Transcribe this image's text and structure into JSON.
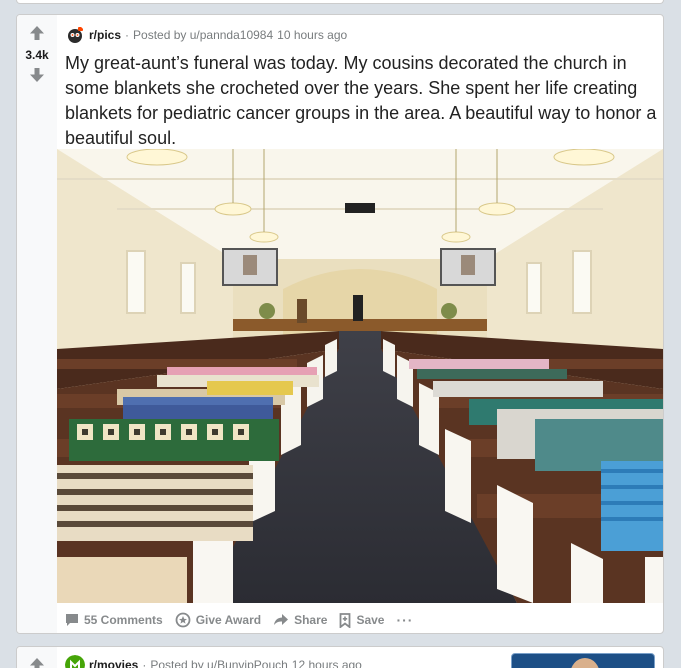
{
  "post": {
    "score": "3.4k",
    "subreddit": "r/pics",
    "posted_by": "Posted by u/pannda10984",
    "time": "10 hours ago",
    "title": "My great-aunt’s funeral was today. My cousins decorated the church in some blankets she crocheted over the years. She spent her life creating blankets for pediatric cancer groups in the area. A beautiful way to honor a beautiful soul.",
    "image_alt": "Church interior with crocheted blankets draped over the ends of the pews",
    "actions": {
      "comments": "55 Comments",
      "award": "Give Award",
      "share": "Share",
      "save": "Save",
      "more": "···"
    }
  },
  "next_post": {
    "subreddit": "r/movies",
    "posted_by": "Posted by u/BunvipPouch",
    "time": "12 hours ago"
  },
  "colors": {
    "page_bg": "#dae0e6",
    "card_bg": "#ffffff",
    "meta_text": "#787c7e",
    "action_text": "#878a8c",
    "movies_icon": "#46a508"
  },
  "icons": {
    "upvote": "arrow-up-icon",
    "downvote": "arrow-down-icon",
    "comments": "comment-icon",
    "award": "award-icon",
    "share": "share-icon",
    "save": "bookmark-icon",
    "more": "ellipsis-icon"
  }
}
